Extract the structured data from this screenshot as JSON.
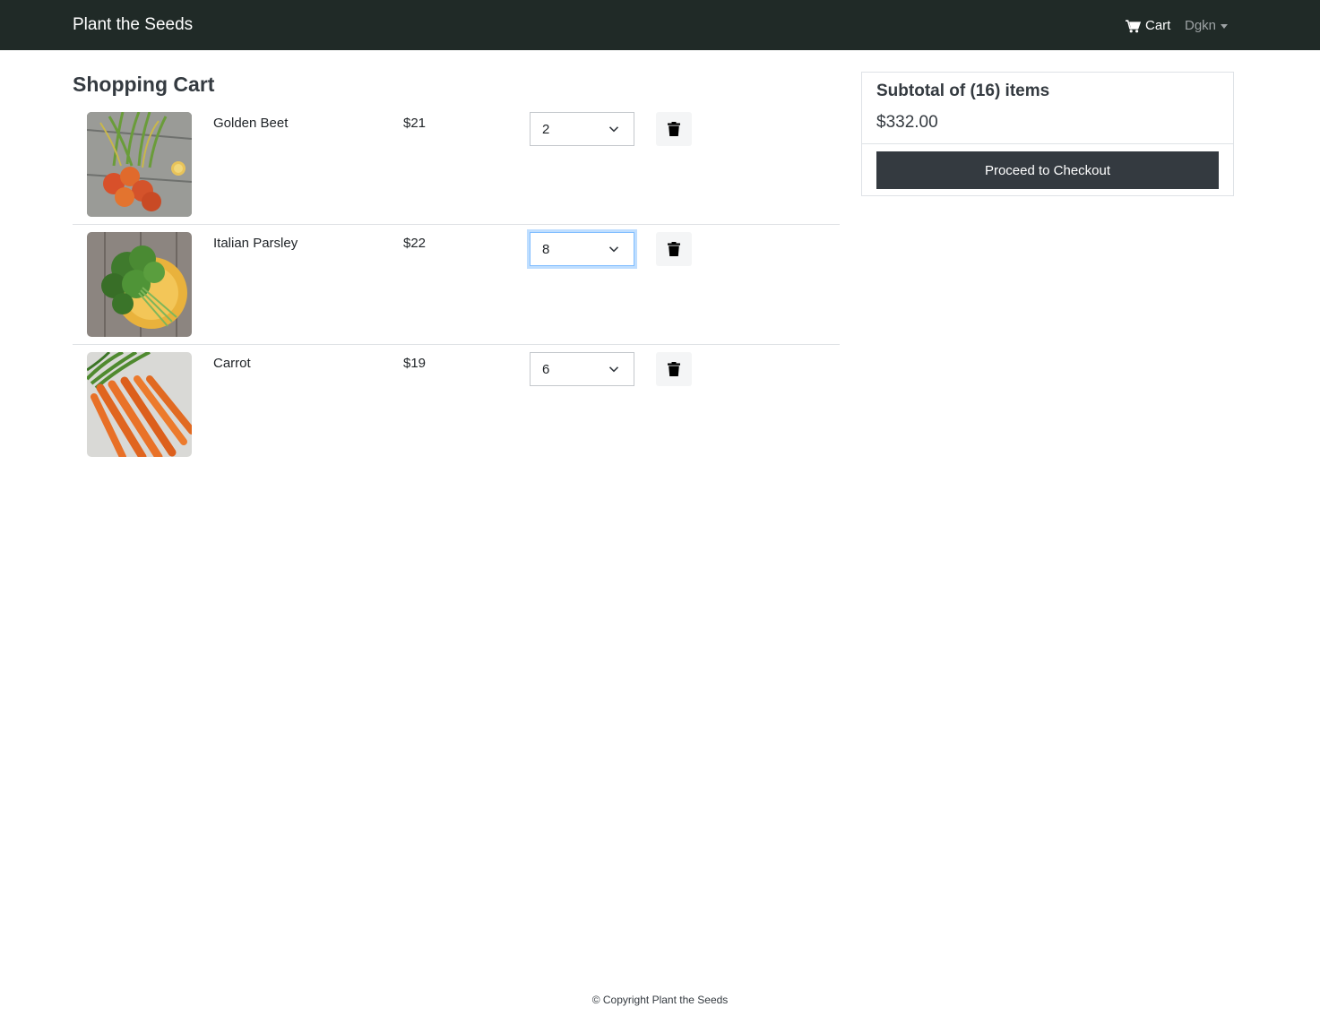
{
  "navbar": {
    "brand": "Plant the Seeds",
    "cart_label": "Cart",
    "cart_icon": "shopping-cart-icon",
    "user_label": "Dgkn"
  },
  "page": {
    "title": "Shopping Cart"
  },
  "cart": {
    "items": [
      {
        "name": "Golden Beet",
        "price": "$21",
        "quantity": "2",
        "image": "golden-beets-photo",
        "delete_icon": "trash-icon"
      },
      {
        "name": "Italian Parsley",
        "price": "$22",
        "quantity": "8",
        "image": "italian-parsley-photo",
        "delete_icon": "trash-icon"
      },
      {
        "name": "Carrot",
        "price": "$19",
        "quantity": "6",
        "image": "carrots-photo",
        "delete_icon": "trash-icon"
      }
    ]
  },
  "summary": {
    "title": "Subtotal of (16) items",
    "total": "$332.00",
    "checkout_label": "Proceed to Checkout"
  },
  "footer": {
    "text": "© Copyright Plant the Seeds"
  },
  "colors": {
    "navbar_bg": "#202a27",
    "checkout_bg": "#343a40",
    "focus_ring": "#80bdff"
  }
}
